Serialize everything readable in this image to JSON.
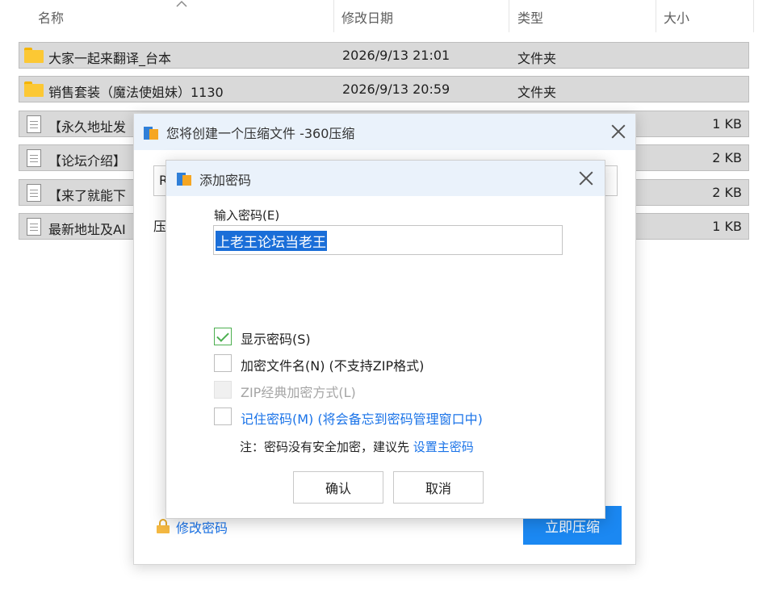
{
  "explorer": {
    "columns": {
      "name": "名称",
      "date": "修改日期",
      "type": "类型",
      "size": "大小"
    },
    "rows": [
      {
        "name": "大家一起来翻译_台本",
        "date": "2026/9/13 21:01",
        "type": "文件夹",
        "size": "",
        "icon": "folder-icon"
      },
      {
        "name": "销售套装（魔法使姐妹）1130",
        "date": "2026/9/13 20:59",
        "type": "文件夹",
        "size": "",
        "icon": "folder-icon"
      },
      {
        "name": "【永久地址发",
        "date": "",
        "type": "",
        "size": "1 KB",
        "icon": "file-icon"
      },
      {
        "name": "【论坛介绍】",
        "date": "",
        "type": "",
        "size": "2 KB",
        "icon": "file-icon"
      },
      {
        "name": "【来了就能下",
        "date": "",
        "type": "",
        "size": "2 KB",
        "icon": "file-icon"
      },
      {
        "name": "最新地址及AI",
        "date": "",
        "type": "",
        "size": "1 KB",
        "icon": "file-icon"
      }
    ]
  },
  "compress_dialog": {
    "title": "您将创建一个压缩文件 -360压缩",
    "field_prefix": "R",
    "label_fragment": "压",
    "modify_password_link": "修改密码",
    "compress_now_button": "立即压缩"
  },
  "password_dialog": {
    "title": "添加密码",
    "input_label": "输入密码(E)",
    "password_value": "上老王论坛当老王",
    "options": {
      "show_password": {
        "label": "显示密码(S)",
        "checked": true
      },
      "encrypt_filenames": {
        "label": "加密文件名(N) (不支持ZIP格式)",
        "checked": false
      },
      "zip_classic": {
        "label": "ZIP经典加密方式(L)",
        "checked": false,
        "disabled": true
      },
      "remember_password": {
        "label": "记住密码(M) (将会备忘到密码管理窗口中)",
        "checked": false
      }
    },
    "note_text": "注：密码没有安全加密，建议先 ",
    "note_link": "设置主密码",
    "ok_button": "确认",
    "cancel_button": "取消"
  },
  "colors": {
    "accent": "#1b88f2",
    "link": "#1a73e8",
    "title_bar": "#eaf2fb",
    "selected_row": "#d9d9d9",
    "check_green": "#4caf50"
  }
}
